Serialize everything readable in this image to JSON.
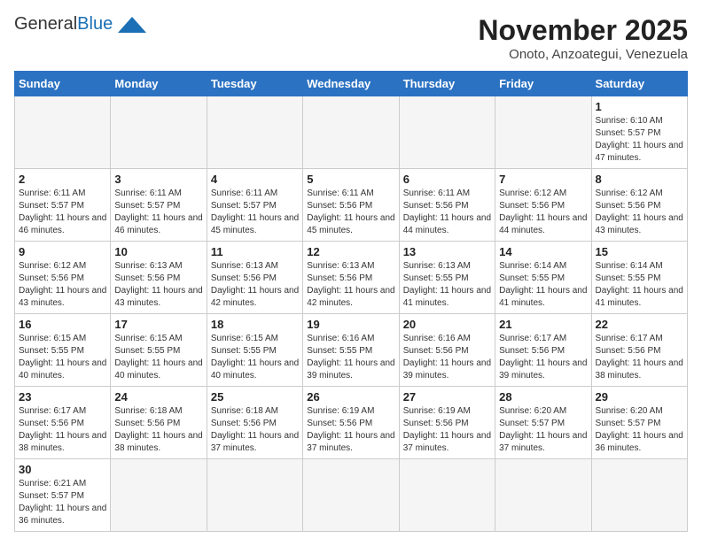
{
  "header": {
    "logo_general": "General",
    "logo_blue": "Blue",
    "month_title": "November 2025",
    "location": "Onoto, Anzoategui, Venezuela"
  },
  "weekdays": [
    "Sunday",
    "Monday",
    "Tuesday",
    "Wednesday",
    "Thursday",
    "Friday",
    "Saturday"
  ],
  "weeks": [
    [
      {
        "day": null
      },
      {
        "day": null
      },
      {
        "day": null
      },
      {
        "day": null
      },
      {
        "day": null
      },
      {
        "day": null
      },
      {
        "day": 1,
        "sunrise": "6:10 AM",
        "sunset": "5:57 PM",
        "daylight": "11 hours and 47 minutes."
      }
    ],
    [
      {
        "day": 2,
        "sunrise": "6:11 AM",
        "sunset": "5:57 PM",
        "daylight": "11 hours and 46 minutes."
      },
      {
        "day": 3,
        "sunrise": "6:11 AM",
        "sunset": "5:57 PM",
        "daylight": "11 hours and 46 minutes."
      },
      {
        "day": 4,
        "sunrise": "6:11 AM",
        "sunset": "5:57 PM",
        "daylight": "11 hours and 45 minutes."
      },
      {
        "day": 5,
        "sunrise": "6:11 AM",
        "sunset": "5:56 PM",
        "daylight": "11 hours and 45 minutes."
      },
      {
        "day": 6,
        "sunrise": "6:11 AM",
        "sunset": "5:56 PM",
        "daylight": "11 hours and 44 minutes."
      },
      {
        "day": 7,
        "sunrise": "6:12 AM",
        "sunset": "5:56 PM",
        "daylight": "11 hours and 44 minutes."
      },
      {
        "day": 8,
        "sunrise": "6:12 AM",
        "sunset": "5:56 PM",
        "daylight": "11 hours and 43 minutes."
      }
    ],
    [
      {
        "day": 9,
        "sunrise": "6:12 AM",
        "sunset": "5:56 PM",
        "daylight": "11 hours and 43 minutes."
      },
      {
        "day": 10,
        "sunrise": "6:13 AM",
        "sunset": "5:56 PM",
        "daylight": "11 hours and 43 minutes."
      },
      {
        "day": 11,
        "sunrise": "6:13 AM",
        "sunset": "5:56 PM",
        "daylight": "11 hours and 42 minutes."
      },
      {
        "day": 12,
        "sunrise": "6:13 AM",
        "sunset": "5:56 PM",
        "daylight": "11 hours and 42 minutes."
      },
      {
        "day": 13,
        "sunrise": "6:13 AM",
        "sunset": "5:55 PM",
        "daylight": "11 hours and 41 minutes."
      },
      {
        "day": 14,
        "sunrise": "6:14 AM",
        "sunset": "5:55 PM",
        "daylight": "11 hours and 41 minutes."
      },
      {
        "day": 15,
        "sunrise": "6:14 AM",
        "sunset": "5:55 PM",
        "daylight": "11 hours and 41 minutes."
      }
    ],
    [
      {
        "day": 16,
        "sunrise": "6:15 AM",
        "sunset": "5:55 PM",
        "daylight": "11 hours and 40 minutes."
      },
      {
        "day": 17,
        "sunrise": "6:15 AM",
        "sunset": "5:55 PM",
        "daylight": "11 hours and 40 minutes."
      },
      {
        "day": 18,
        "sunrise": "6:15 AM",
        "sunset": "5:55 PM",
        "daylight": "11 hours and 40 minutes."
      },
      {
        "day": 19,
        "sunrise": "6:16 AM",
        "sunset": "5:55 PM",
        "daylight": "11 hours and 39 minutes."
      },
      {
        "day": 20,
        "sunrise": "6:16 AM",
        "sunset": "5:56 PM",
        "daylight": "11 hours and 39 minutes."
      },
      {
        "day": 21,
        "sunrise": "6:17 AM",
        "sunset": "5:56 PM",
        "daylight": "11 hours and 39 minutes."
      },
      {
        "day": 22,
        "sunrise": "6:17 AM",
        "sunset": "5:56 PM",
        "daylight": "11 hours and 38 minutes."
      }
    ],
    [
      {
        "day": 23,
        "sunrise": "6:17 AM",
        "sunset": "5:56 PM",
        "daylight": "11 hours and 38 minutes."
      },
      {
        "day": 24,
        "sunrise": "6:18 AM",
        "sunset": "5:56 PM",
        "daylight": "11 hours and 38 minutes."
      },
      {
        "day": 25,
        "sunrise": "6:18 AM",
        "sunset": "5:56 PM",
        "daylight": "11 hours and 37 minutes."
      },
      {
        "day": 26,
        "sunrise": "6:19 AM",
        "sunset": "5:56 PM",
        "daylight": "11 hours and 37 minutes."
      },
      {
        "day": 27,
        "sunrise": "6:19 AM",
        "sunset": "5:56 PM",
        "daylight": "11 hours and 37 minutes."
      },
      {
        "day": 28,
        "sunrise": "6:20 AM",
        "sunset": "5:57 PM",
        "daylight": "11 hours and 37 minutes."
      },
      {
        "day": 29,
        "sunrise": "6:20 AM",
        "sunset": "5:57 PM",
        "daylight": "11 hours and 36 minutes."
      }
    ],
    [
      {
        "day": 30,
        "sunrise": "6:21 AM",
        "sunset": "5:57 PM",
        "daylight": "11 hours and 36 minutes."
      },
      {
        "day": null
      },
      {
        "day": null
      },
      {
        "day": null
      },
      {
        "day": null
      },
      {
        "day": null
      },
      {
        "day": null
      }
    ]
  ],
  "labels": {
    "sunrise": "Sunrise:",
    "sunset": "Sunset:",
    "daylight": "Daylight:"
  }
}
